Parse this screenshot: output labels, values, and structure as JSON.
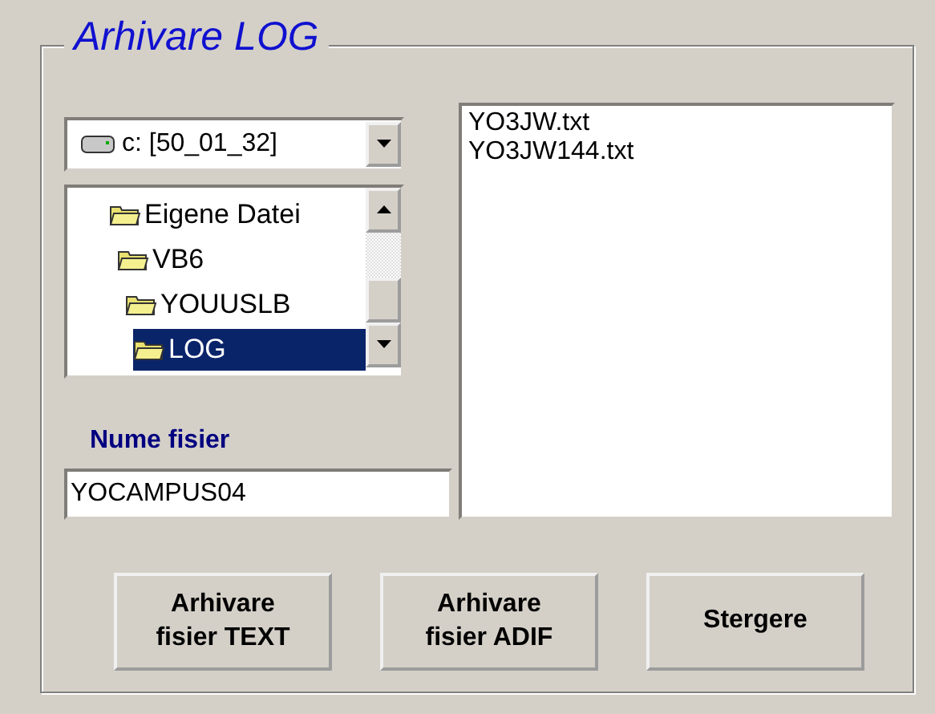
{
  "frame": {
    "title": "Arhivare LOG"
  },
  "drive": {
    "value": "c: [50_01_32]"
  },
  "folders": [
    {
      "name": "Eigene Datei",
      "selected": false,
      "children": [
        {
          "name": "VB6",
          "selected": false,
          "children": [
            {
              "name": "YOUUSLB",
              "selected": false,
              "children": [
                {
                  "name": "LOG",
                  "selected": true
                }
              ]
            }
          ]
        }
      ]
    }
  ],
  "file_name": {
    "label": "Nume fisier",
    "value": "YOCAMPUS04"
  },
  "files": [
    {
      "name": "YO3JW.txt",
      "selected": false
    },
    {
      "name": "YO3JW144.txt",
      "selected": false
    }
  ],
  "buttons": [
    "Arhivare\nfisier TEXT",
    "Arhivare\nfisier ADIF",
    "Stergere"
  ]
}
